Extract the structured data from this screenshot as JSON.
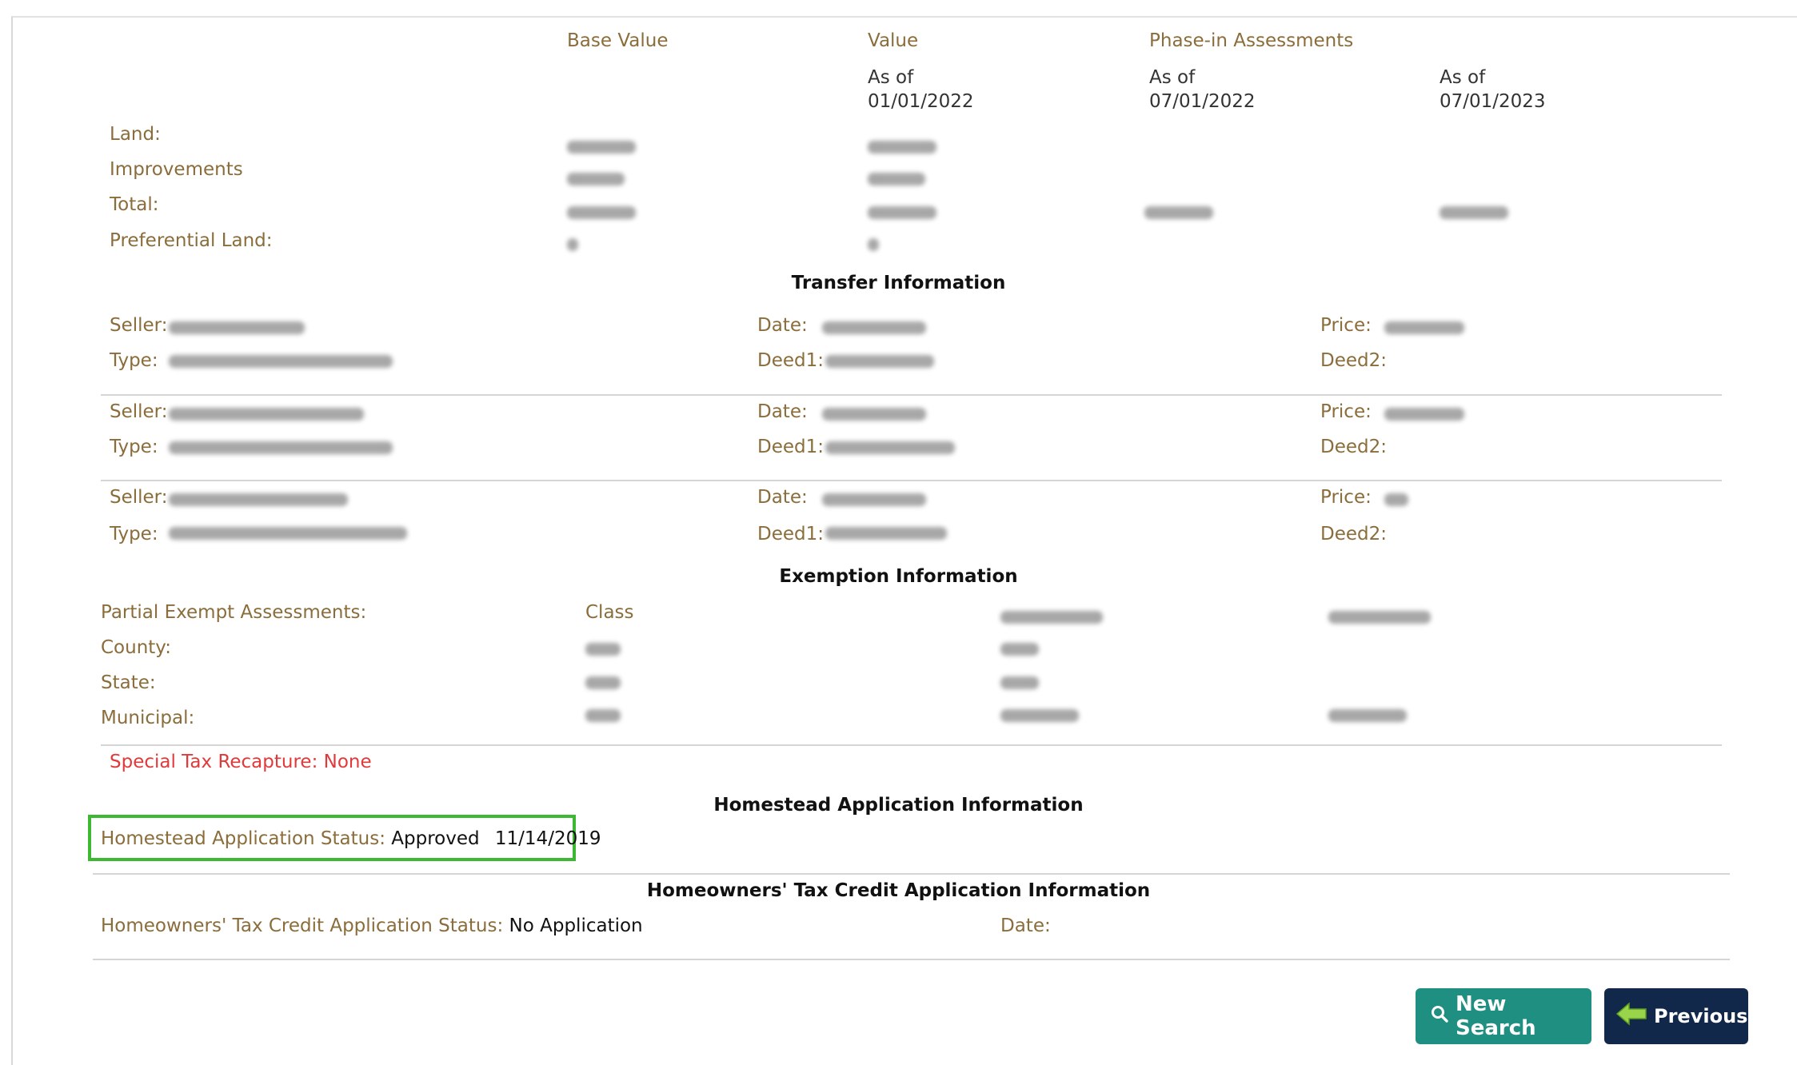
{
  "assessment": {
    "col_base_value": "Base Value",
    "col_value": "Value",
    "col_phase_in": "Phase-in Assessments",
    "value_as_of_label": "As of",
    "value_as_of_date": "01/01/2022",
    "phase1_as_of_label": "As of",
    "phase1_as_of_date": "07/01/2022",
    "phase2_as_of_label": "As of",
    "phase2_as_of_date": "07/01/2023",
    "rows": [
      {
        "label": "Land:"
      },
      {
        "label": "Improvements"
      },
      {
        "label": "Total:"
      },
      {
        "label": "Preferential Land:"
      }
    ]
  },
  "transfer": {
    "title": "Transfer Information",
    "seller_label": "Seller:",
    "type_label": "Type:",
    "date_label": "Date:",
    "deed1_label": "Deed1:",
    "price_label": "Price:",
    "deed2_label": "Deed2:"
  },
  "exemption": {
    "title": "Exemption Information",
    "partial_label": "Partial Exempt Assessments:",
    "class_label": "Class",
    "county_label": "County:",
    "state_label": "State:",
    "municipal_label": "Municipal:",
    "special_tax_label": "Special Tax Recapture:",
    "special_tax_value": "None"
  },
  "homestead": {
    "title": "Homestead Application Information",
    "status_label": "Homestead Application Status:",
    "status_value": "Approved",
    "status_date": "11/14/2019"
  },
  "homeowners": {
    "title": "Homeowners' Tax Credit Application Information",
    "status_label": "Homeowners' Tax Credit Application Status:",
    "status_value": "No Application",
    "date_label": "Date:"
  },
  "buttons": {
    "new_search": "New Search",
    "previous": "Previous"
  },
  "colors": {
    "label_brown": "#8a6d3b",
    "highlight_green": "#3cb832",
    "new_search_teal": "#1f8f82",
    "previous_navy": "#12284a",
    "special_tax_red": "#e23a3a"
  },
  "icons": [
    "search-icon",
    "arrow-left-icon"
  ]
}
